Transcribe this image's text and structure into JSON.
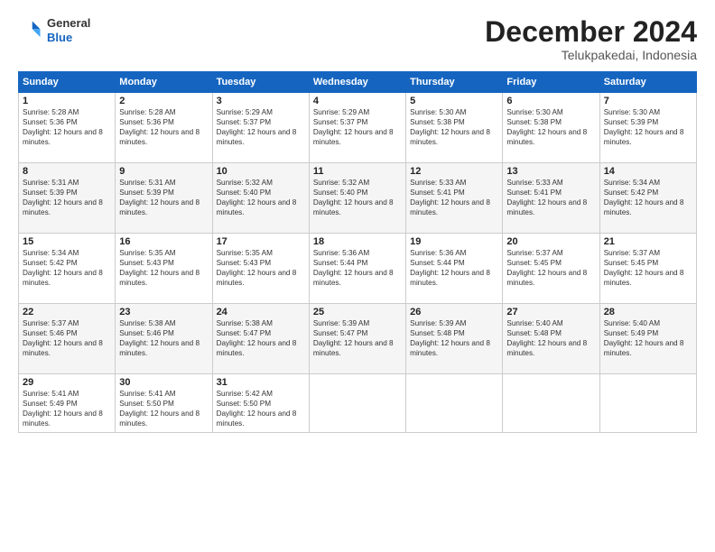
{
  "logo": {
    "line1": "General",
    "line2": "Blue"
  },
  "title": "December 2024",
  "location": "Telukpakedai, Indonesia",
  "weekdays": [
    "Sunday",
    "Monday",
    "Tuesday",
    "Wednesday",
    "Thursday",
    "Friday",
    "Saturday"
  ],
  "weeks": [
    [
      {
        "day": "1",
        "sunrise": "5:28 AM",
        "sunset": "5:36 PM",
        "daylight": "12 hours and 8 minutes."
      },
      {
        "day": "2",
        "sunrise": "5:28 AM",
        "sunset": "5:36 PM",
        "daylight": "12 hours and 8 minutes."
      },
      {
        "day": "3",
        "sunrise": "5:29 AM",
        "sunset": "5:37 PM",
        "daylight": "12 hours and 8 minutes."
      },
      {
        "day": "4",
        "sunrise": "5:29 AM",
        "sunset": "5:37 PM",
        "daylight": "12 hours and 8 minutes."
      },
      {
        "day": "5",
        "sunrise": "5:30 AM",
        "sunset": "5:38 PM",
        "daylight": "12 hours and 8 minutes."
      },
      {
        "day": "6",
        "sunrise": "5:30 AM",
        "sunset": "5:38 PM",
        "daylight": "12 hours and 8 minutes."
      },
      {
        "day": "7",
        "sunrise": "5:30 AM",
        "sunset": "5:39 PM",
        "daylight": "12 hours and 8 minutes."
      }
    ],
    [
      {
        "day": "8",
        "sunrise": "5:31 AM",
        "sunset": "5:39 PM",
        "daylight": "12 hours and 8 minutes."
      },
      {
        "day": "9",
        "sunrise": "5:31 AM",
        "sunset": "5:39 PM",
        "daylight": "12 hours and 8 minutes."
      },
      {
        "day": "10",
        "sunrise": "5:32 AM",
        "sunset": "5:40 PM",
        "daylight": "12 hours and 8 minutes."
      },
      {
        "day": "11",
        "sunrise": "5:32 AM",
        "sunset": "5:40 PM",
        "daylight": "12 hours and 8 minutes."
      },
      {
        "day": "12",
        "sunrise": "5:33 AM",
        "sunset": "5:41 PM",
        "daylight": "12 hours and 8 minutes."
      },
      {
        "day": "13",
        "sunrise": "5:33 AM",
        "sunset": "5:41 PM",
        "daylight": "12 hours and 8 minutes."
      },
      {
        "day": "14",
        "sunrise": "5:34 AM",
        "sunset": "5:42 PM",
        "daylight": "12 hours and 8 minutes."
      }
    ],
    [
      {
        "day": "15",
        "sunrise": "5:34 AM",
        "sunset": "5:42 PM",
        "daylight": "12 hours and 8 minutes."
      },
      {
        "day": "16",
        "sunrise": "5:35 AM",
        "sunset": "5:43 PM",
        "daylight": "12 hours and 8 minutes."
      },
      {
        "day": "17",
        "sunrise": "5:35 AM",
        "sunset": "5:43 PM",
        "daylight": "12 hours and 8 minutes."
      },
      {
        "day": "18",
        "sunrise": "5:36 AM",
        "sunset": "5:44 PM",
        "daylight": "12 hours and 8 minutes."
      },
      {
        "day": "19",
        "sunrise": "5:36 AM",
        "sunset": "5:44 PM",
        "daylight": "12 hours and 8 minutes."
      },
      {
        "day": "20",
        "sunrise": "5:37 AM",
        "sunset": "5:45 PM",
        "daylight": "12 hours and 8 minutes."
      },
      {
        "day": "21",
        "sunrise": "5:37 AM",
        "sunset": "5:45 PM",
        "daylight": "12 hours and 8 minutes."
      }
    ],
    [
      {
        "day": "22",
        "sunrise": "5:37 AM",
        "sunset": "5:46 PM",
        "daylight": "12 hours and 8 minutes."
      },
      {
        "day": "23",
        "sunrise": "5:38 AM",
        "sunset": "5:46 PM",
        "daylight": "12 hours and 8 minutes."
      },
      {
        "day": "24",
        "sunrise": "5:38 AM",
        "sunset": "5:47 PM",
        "daylight": "12 hours and 8 minutes."
      },
      {
        "day": "25",
        "sunrise": "5:39 AM",
        "sunset": "5:47 PM",
        "daylight": "12 hours and 8 minutes."
      },
      {
        "day": "26",
        "sunrise": "5:39 AM",
        "sunset": "5:48 PM",
        "daylight": "12 hours and 8 minutes."
      },
      {
        "day": "27",
        "sunrise": "5:40 AM",
        "sunset": "5:48 PM",
        "daylight": "12 hours and 8 minutes."
      },
      {
        "day": "28",
        "sunrise": "5:40 AM",
        "sunset": "5:49 PM",
        "daylight": "12 hours and 8 minutes."
      }
    ],
    [
      {
        "day": "29",
        "sunrise": "5:41 AM",
        "sunset": "5:49 PM",
        "daylight": "12 hours and 8 minutes."
      },
      {
        "day": "30",
        "sunrise": "5:41 AM",
        "sunset": "5:50 PM",
        "daylight": "12 hours and 8 minutes."
      },
      {
        "day": "31",
        "sunrise": "5:42 AM",
        "sunset": "5:50 PM",
        "daylight": "12 hours and 8 minutes."
      },
      null,
      null,
      null,
      null
    ]
  ]
}
